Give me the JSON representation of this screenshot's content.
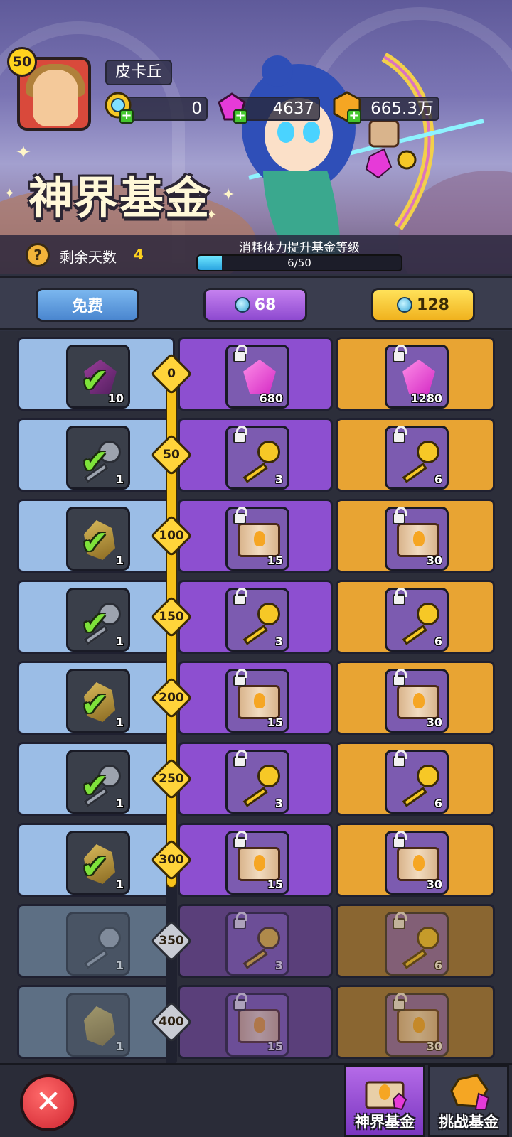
{
  "player": {
    "level": "50",
    "name": "皮卡丘"
  },
  "currencies": [
    {
      "icon": "blue-gem-icon",
      "value": "0",
      "color": "#4fc3f7"
    },
    {
      "icon": "pink-diamond-icon",
      "value": "4637",
      "color": "#e63ad8"
    },
    {
      "icon": "gold-coin-icon",
      "value": "665.3万",
      "color": "#f5a623"
    }
  ],
  "banner": {
    "title": "神界基金"
  },
  "progress": {
    "days_label": "剩余天数",
    "days_value": "4",
    "caption": "消耗体力提升基金等级",
    "value_text": "6/50",
    "fraction": 0.12
  },
  "tiers": {
    "free": "免费",
    "purple": "68",
    "gold": "128"
  },
  "rows": [
    {
      "level": "0",
      "free": {
        "icon": "gem",
        "qty": "10",
        "claimed": true
      },
      "purple": {
        "icon": "gem",
        "qty": "680"
      },
      "gold": {
        "icon": "gem",
        "qty": "1280"
      },
      "unlocked": true
    },
    {
      "level": "50",
      "free": {
        "icon": "key",
        "qty": "1",
        "claimed": true
      },
      "purple": {
        "icon": "key",
        "qty": "3"
      },
      "gold": {
        "icon": "key",
        "qty": "6"
      },
      "unlocked": true
    },
    {
      "level": "100",
      "free": {
        "icon": "ore",
        "qty": "1",
        "claimed": true
      },
      "purple": {
        "icon": "book",
        "qty": "15"
      },
      "gold": {
        "icon": "book",
        "qty": "30"
      },
      "unlocked": true
    },
    {
      "level": "150",
      "free": {
        "icon": "key",
        "qty": "1",
        "claimed": true
      },
      "purple": {
        "icon": "key",
        "qty": "3"
      },
      "gold": {
        "icon": "key",
        "qty": "6"
      },
      "unlocked": true
    },
    {
      "level": "200",
      "free": {
        "icon": "ore",
        "qty": "1",
        "claimed": true
      },
      "purple": {
        "icon": "book",
        "qty": "15"
      },
      "gold": {
        "icon": "book",
        "qty": "30"
      },
      "unlocked": true
    },
    {
      "level": "250",
      "free": {
        "icon": "key",
        "qty": "1",
        "claimed": true
      },
      "purple": {
        "icon": "key",
        "qty": "3"
      },
      "gold": {
        "icon": "key",
        "qty": "6"
      },
      "unlocked": true
    },
    {
      "level": "300",
      "free": {
        "icon": "ore",
        "qty": "1",
        "claimed": true
      },
      "purple": {
        "icon": "book",
        "qty": "15"
      },
      "gold": {
        "icon": "book",
        "qty": "30"
      },
      "unlocked": true
    },
    {
      "level": "350",
      "free": {
        "icon": "key",
        "qty": "1",
        "claimed": false
      },
      "purple": {
        "icon": "key",
        "qty": "3"
      },
      "gold": {
        "icon": "key",
        "qty": "6"
      },
      "unlocked": false
    },
    {
      "level": "400",
      "free": {
        "icon": "ore",
        "qty": "1",
        "claimed": false
      },
      "purple": {
        "icon": "book",
        "qty": "15"
      },
      "gold": {
        "icon": "book",
        "qty": "30"
      },
      "unlocked": false
    }
  ],
  "bottom_nav": {
    "close_icon": "close-icon",
    "tabs": [
      {
        "label": "神界基金",
        "active": true
      },
      {
        "label": "挑战基金",
        "active": false
      }
    ]
  }
}
